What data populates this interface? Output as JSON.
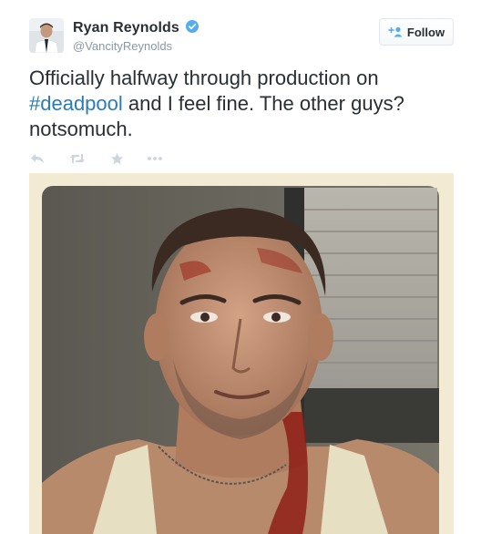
{
  "user": {
    "display_name": "Ryan Reynolds",
    "handle": "@VancityReynolds",
    "verified": true
  },
  "follow_button": {
    "label": "Follow"
  },
  "tweet": {
    "text_before": "Officially halfway through production on ",
    "hashtag": "#deadpool",
    "text_after": " and I feel fine. The other guys? notsomuch."
  },
  "actions": {
    "icons": [
      "reply-icon",
      "retweet-icon",
      "favorite-icon",
      "more-icon"
    ]
  },
  "colors": {
    "text": "#292f33",
    "muted": "#8899a6",
    "link": "#2b7bb9",
    "verified": "#55acee",
    "action_icon": "#ccd6dd"
  }
}
